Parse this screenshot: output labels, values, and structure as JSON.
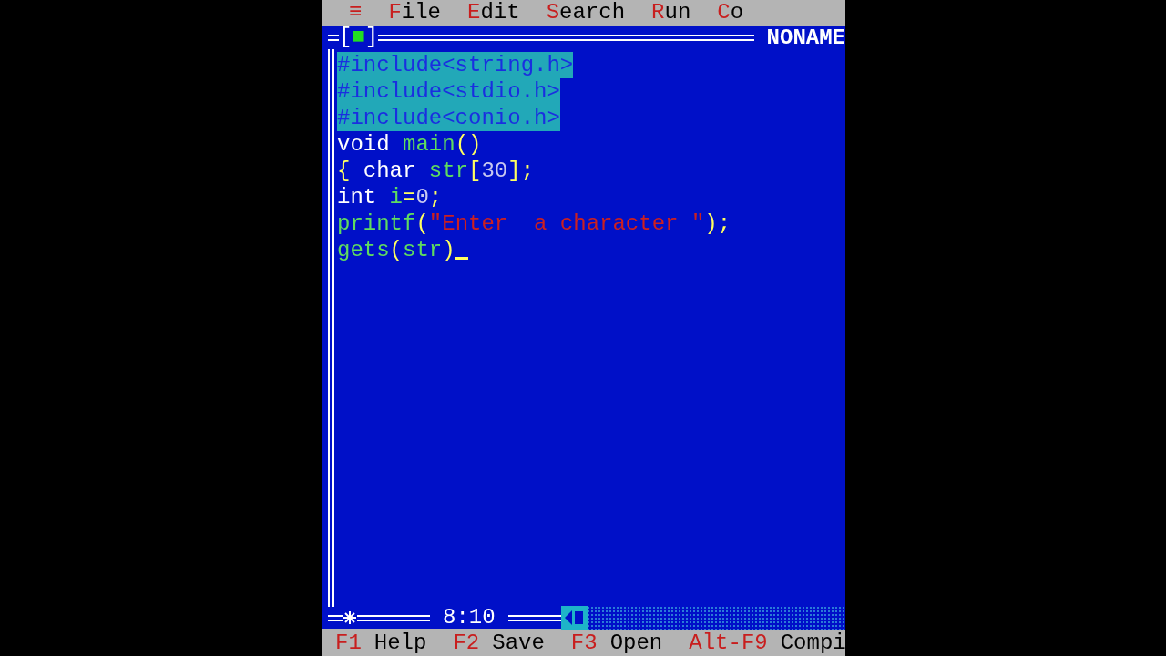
{
  "menu": [
    {
      "label": "≡",
      "kind": "system"
    },
    {
      "label": "File",
      "kind": "menu"
    },
    {
      "label": "Edit",
      "kind": "menu"
    },
    {
      "label": "Search",
      "kind": "menu"
    },
    {
      "label": "Run",
      "kind": "menu"
    },
    {
      "label": "Co",
      "kind": "menu"
    }
  ],
  "editor": {
    "close_box": "[■]",
    "title": "NONAME",
    "position": "8:10",
    "modified": true,
    "lines": [
      {
        "selected": true,
        "cursor": false,
        "tokens": [
          {
            "text": "#include<string.h>",
            "kind": "preprocessor"
          }
        ]
      },
      {
        "selected": true,
        "cursor": false,
        "tokens": [
          {
            "text": "#include<stdio.h>",
            "kind": "preprocessor"
          }
        ]
      },
      {
        "selected": true,
        "cursor": false,
        "tokens": [
          {
            "text": "#include<conio.h>",
            "kind": "preprocessor"
          }
        ]
      },
      {
        "selected": false,
        "cursor": false,
        "tokens": [
          {
            "text": "void",
            "kind": "keyword"
          },
          {
            "text": " main",
            "kind": "ident"
          },
          {
            "text": "()",
            "kind": "symbol"
          }
        ]
      },
      {
        "selected": false,
        "cursor": false,
        "tokens": [
          {
            "text": "{",
            "kind": "symbol"
          },
          {
            "text": " char",
            "kind": "keyword"
          },
          {
            "text": " str",
            "kind": "ident"
          },
          {
            "text": "[",
            "kind": "symbol"
          },
          {
            "text": "30",
            "kind": "number"
          },
          {
            "text": "];",
            "kind": "symbol"
          }
        ]
      },
      {
        "selected": false,
        "cursor": false,
        "tokens": [
          {
            "text": "int",
            "kind": "keyword"
          },
          {
            "text": " i",
            "kind": "ident"
          },
          {
            "text": "=",
            "kind": "symbol"
          },
          {
            "text": "0",
            "kind": "number"
          },
          {
            "text": ";",
            "kind": "symbol"
          }
        ]
      },
      {
        "selected": false,
        "cursor": false,
        "tokens": [
          {
            "text": "printf",
            "kind": "ident"
          },
          {
            "text": "(",
            "kind": "symbol"
          },
          {
            "text": "\"Enter  a character \"",
            "kind": "string"
          },
          {
            "text": ");",
            "kind": "symbol"
          }
        ]
      },
      {
        "selected": false,
        "cursor": true,
        "tokens": [
          {
            "text": "gets",
            "kind": "ident"
          },
          {
            "text": "(",
            "kind": "symbol"
          },
          {
            "text": "str",
            "kind": "ident"
          },
          {
            "text": ")",
            "kind": "symbol"
          }
        ]
      }
    ]
  },
  "status_bar": [
    {
      "key": "F1",
      "label": "Help"
    },
    {
      "key": "F2",
      "label": "Save"
    },
    {
      "key": "F3",
      "label": "Open"
    },
    {
      "key": "Alt-F9",
      "label": "Compi"
    }
  ]
}
